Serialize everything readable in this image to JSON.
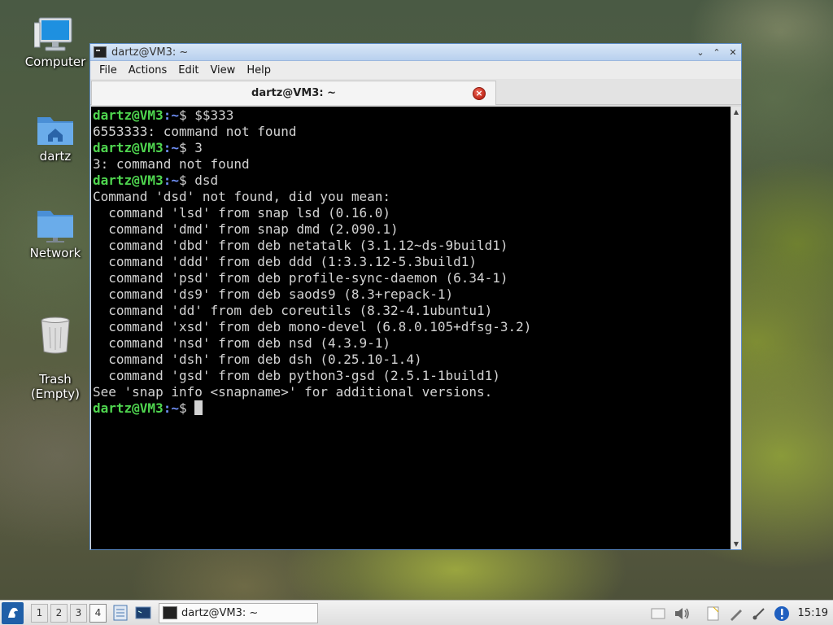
{
  "desktop": {
    "icons": [
      {
        "label": "Computer"
      },
      {
        "label": "dartz"
      },
      {
        "label": "Network"
      },
      {
        "label": "Trash\n(Empty)"
      }
    ]
  },
  "window": {
    "title": "dartz@VM3: ~",
    "menu": [
      "File",
      "Actions",
      "Edit",
      "View",
      "Help"
    ],
    "tab_label": "dartz@VM3: ~",
    "terminal": {
      "prompt_user": "dartz@VM3",
      "prompt_path": ":~",
      "prompt_sym": "$ ",
      "lines": [
        {
          "prompt": true,
          "cmd": "$$333"
        },
        {
          "text": "6553333: command not found"
        },
        {
          "prompt": true,
          "cmd": "3"
        },
        {
          "text": "3: command not found"
        },
        {
          "prompt": true,
          "cmd": "dsd"
        },
        {
          "text": "Command 'dsd' not found, did you mean:"
        },
        {
          "text": "  command 'lsd' from snap lsd (0.16.0)"
        },
        {
          "text": "  command 'dmd' from snap dmd (2.090.1)"
        },
        {
          "text": "  command 'dbd' from deb netatalk (3.1.12~ds-9build1)"
        },
        {
          "text": "  command 'ddd' from deb ddd (1:3.3.12-5.3build1)"
        },
        {
          "text": "  command 'psd' from deb profile-sync-daemon (6.34-1)"
        },
        {
          "text": "  command 'ds9' from deb saods9 (8.3+repack-1)"
        },
        {
          "text": "  command 'dd' from deb coreutils (8.32-4.1ubuntu1)"
        },
        {
          "text": "  command 'xsd' from deb mono-devel (6.8.0.105+dfsg-3.2)"
        },
        {
          "text": "  command 'nsd' from deb nsd (4.3.9-1)"
        },
        {
          "text": "  command 'dsh' from deb dsh (0.25.10-1.4)"
        },
        {
          "text": "  command 'gsd' from deb python3-gsd (2.5.1-1build1)"
        },
        {
          "text": "See 'snap info <snapname>' for additional versions."
        },
        {
          "prompt": true,
          "cmd": "",
          "cursor": true
        }
      ]
    }
  },
  "taskbar": {
    "workspaces": [
      "1",
      "2",
      "3",
      "4"
    ],
    "active_workspace": "4",
    "task_label": "dartz@VM3: ~",
    "clock": "15:19"
  },
  "colors": {
    "prompt_user": "#4fd64f",
    "prompt_path": "#6f8ff5",
    "terminal_bg": "#000000",
    "terminal_fg": "#d3d3d3"
  }
}
